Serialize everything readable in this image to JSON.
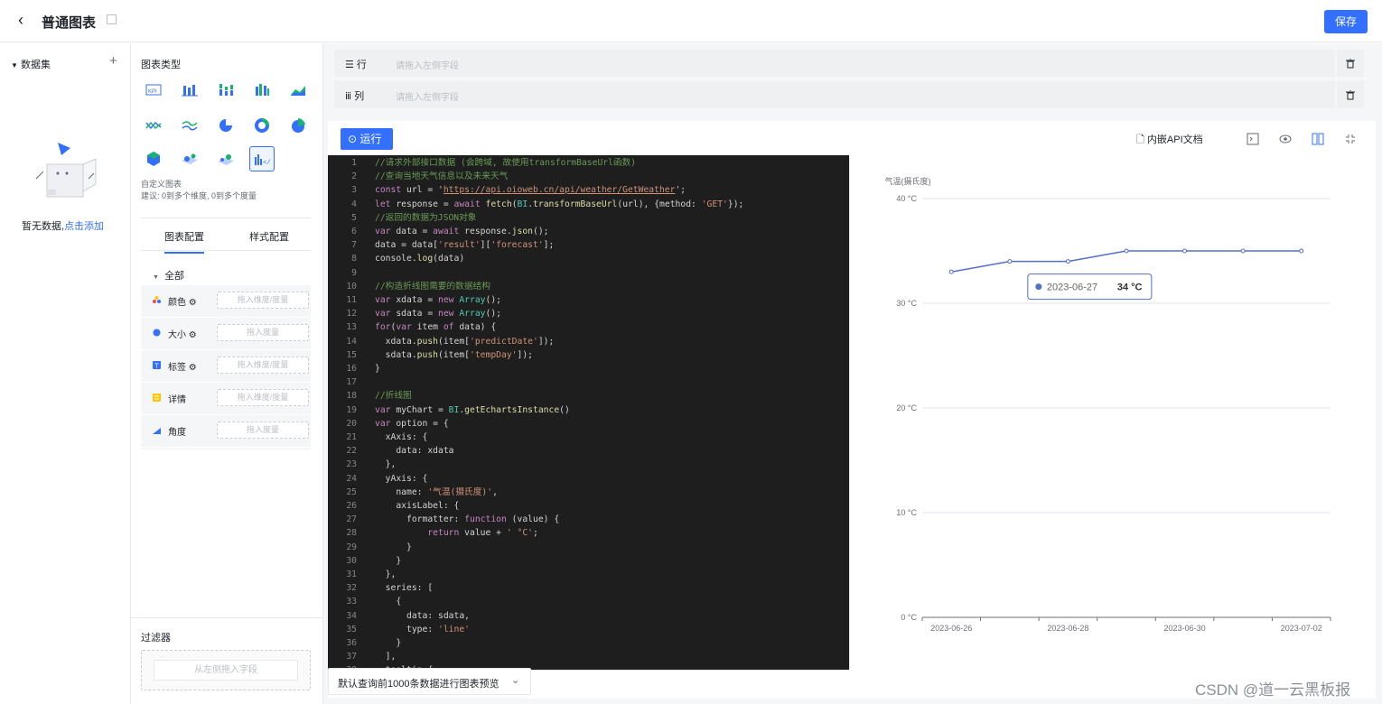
{
  "header": {
    "title": "普通图表",
    "save_label": "保存"
  },
  "dataset": {
    "title": "数据集",
    "empty_text": "暂无数据,",
    "empty_link": "点击添加"
  },
  "chart_types": {
    "title": "图表类型",
    "icons": [
      "kpi-icon",
      "bar-chart-icon",
      "stacked-bar-icon",
      "grouped-bar-icon",
      "area-chart-icon",
      "line-chart-icon",
      "multi-line-icon",
      "pie-chart-icon",
      "donut-chart-icon",
      "rose-chart-icon",
      "map-icon",
      "scatter-map-icon",
      "flow-map-icon",
      "custom-chart-icon"
    ],
    "selected_name": "自定义图表",
    "selected_hint": "建议: 0到多个维度, 0到多个度量"
  },
  "config_tabs": [
    "图表配置",
    "样式配置"
  ],
  "config": {
    "all_label": "全部",
    "attrs": [
      {
        "label": "颜色",
        "drop": "拖入维度/度量",
        "icon": "color-icon"
      },
      {
        "label": "大小",
        "drop": "拖入度量",
        "icon": "size-icon"
      },
      {
        "label": "标签",
        "drop": "拖入维度/度量",
        "icon": "label-icon"
      },
      {
        "label": "详情",
        "drop": "拖入维度/度量",
        "icon": "detail-icon"
      },
      {
        "label": "角度",
        "drop": "拖入度量",
        "icon": "angle-icon"
      }
    ]
  },
  "filter": {
    "title": "过滤器",
    "placeholder": "从左侧拖入字段"
  },
  "fields": {
    "row_label": "☰ 行",
    "row_placeholder": "请拖入左侧字段",
    "col_label": "ⅲ 列",
    "col_placeholder": "请拖入左侧字段"
  },
  "toolbar": {
    "run_label": "运行",
    "api_doc_label": "内嵌API文档"
  },
  "code_lines": [
    {
      "n": "1",
      "t": "//请求外部接口数据 (会跨域, 故使用transformBaseUrl函数)",
      "c": "comment"
    },
    {
      "n": "2",
      "t": "//查询当地天气信息以及未来天气",
      "c": "comment"
    },
    {
      "n": "3",
      "t": "const url = 'https://api.oioweb.cn/api/weather/GetWeather';",
      "c": "code"
    },
    {
      "n": "4",
      "t": "let response = await fetch(BI.transformBaseUrl(url), {method: 'GET'});",
      "c": "code"
    },
    {
      "n": "5",
      "t": "//返回的数据为JSON对象",
      "c": "comment"
    },
    {
      "n": "6",
      "t": "var data = await response.json();",
      "c": "code"
    },
    {
      "n": "7",
      "t": "data = data['result']['forecast'];",
      "c": "code"
    },
    {
      "n": "8",
      "t": "console.log(data)",
      "c": "code"
    },
    {
      "n": "9",
      "t": "",
      "c": "code"
    },
    {
      "n": "10",
      "t": "//构造折线图需要的数据结构",
      "c": "comment"
    },
    {
      "n": "11",
      "t": "var xdata = new Array();",
      "c": "code"
    },
    {
      "n": "12",
      "t": "var sdata = new Array();",
      "c": "code"
    },
    {
      "n": "13",
      "t": "for(var item of data) {",
      "c": "code"
    },
    {
      "n": "14",
      "t": "  xdata.push(item['predictDate']);",
      "c": "code"
    },
    {
      "n": "15",
      "t": "  sdata.push(item['tempDay']);",
      "c": "code"
    },
    {
      "n": "16",
      "t": "}",
      "c": "code"
    },
    {
      "n": "17",
      "t": "",
      "c": "code"
    },
    {
      "n": "18",
      "t": "//折线图",
      "c": "comment"
    },
    {
      "n": "19",
      "t": "var myChart = BI.getEchartsInstance()",
      "c": "code"
    },
    {
      "n": "20",
      "t": "var option = {",
      "c": "code"
    },
    {
      "n": "21",
      "t": "  xAxis: {",
      "c": "code"
    },
    {
      "n": "22",
      "t": "    data: xdata",
      "c": "code"
    },
    {
      "n": "23",
      "t": "  },",
      "c": "code"
    },
    {
      "n": "24",
      "t": "  yAxis: {",
      "c": "code"
    },
    {
      "n": "25",
      "t": "    name: '气温(摄氏度)',",
      "c": "code"
    },
    {
      "n": "26",
      "t": "    axisLabel: {",
      "c": "code"
    },
    {
      "n": "27",
      "t": "      formatter: function (value) {",
      "c": "code"
    },
    {
      "n": "28",
      "t": "          return value + ' °C';",
      "c": "code"
    },
    {
      "n": "29",
      "t": "      }",
      "c": "code"
    },
    {
      "n": "30",
      "t": "    }",
      "c": "code"
    },
    {
      "n": "31",
      "t": "  },",
      "c": "code"
    },
    {
      "n": "32",
      "t": "  series: [",
      "c": "code"
    },
    {
      "n": "33",
      "t": "    {",
      "c": "code"
    },
    {
      "n": "34",
      "t": "      data: sdata,",
      "c": "code"
    },
    {
      "n": "35",
      "t": "      type: 'line'",
      "c": "code"
    },
    {
      "n": "36",
      "t": "    }",
      "c": "code"
    },
    {
      "n": "37",
      "t": "  ],",
      "c": "code"
    },
    {
      "n": "38",
      "t": "  tooltip:{",
      "c": "code"
    }
  ],
  "chart_data": {
    "type": "line",
    "ylabel": "气温(摄氏度)",
    "x": [
      "2023-06-26",
      "2023-06-27",
      "2023-06-28",
      "2023-06-29",
      "2023-06-30",
      "2023-07-01",
      "2023-07-02"
    ],
    "x_tick_labels": [
      "2023-06-26",
      "2023-06-28",
      "2023-06-30",
      "2023-07-02"
    ],
    "values": [
      33,
      34,
      34,
      35,
      35,
      35,
      35
    ],
    "ylim": [
      0,
      40
    ],
    "y_ticks": [
      "0 °C",
      "10 °C",
      "20 °C",
      "30 °C",
      "40 °C"
    ],
    "line_color": "#5470c6",
    "tooltip": {
      "date": "2023-06-27",
      "value": "34 °C"
    }
  },
  "preview": {
    "label": "默认查询前1000条数据进行图表预览"
  },
  "watermark": "CSDN @道一云黑板报"
}
